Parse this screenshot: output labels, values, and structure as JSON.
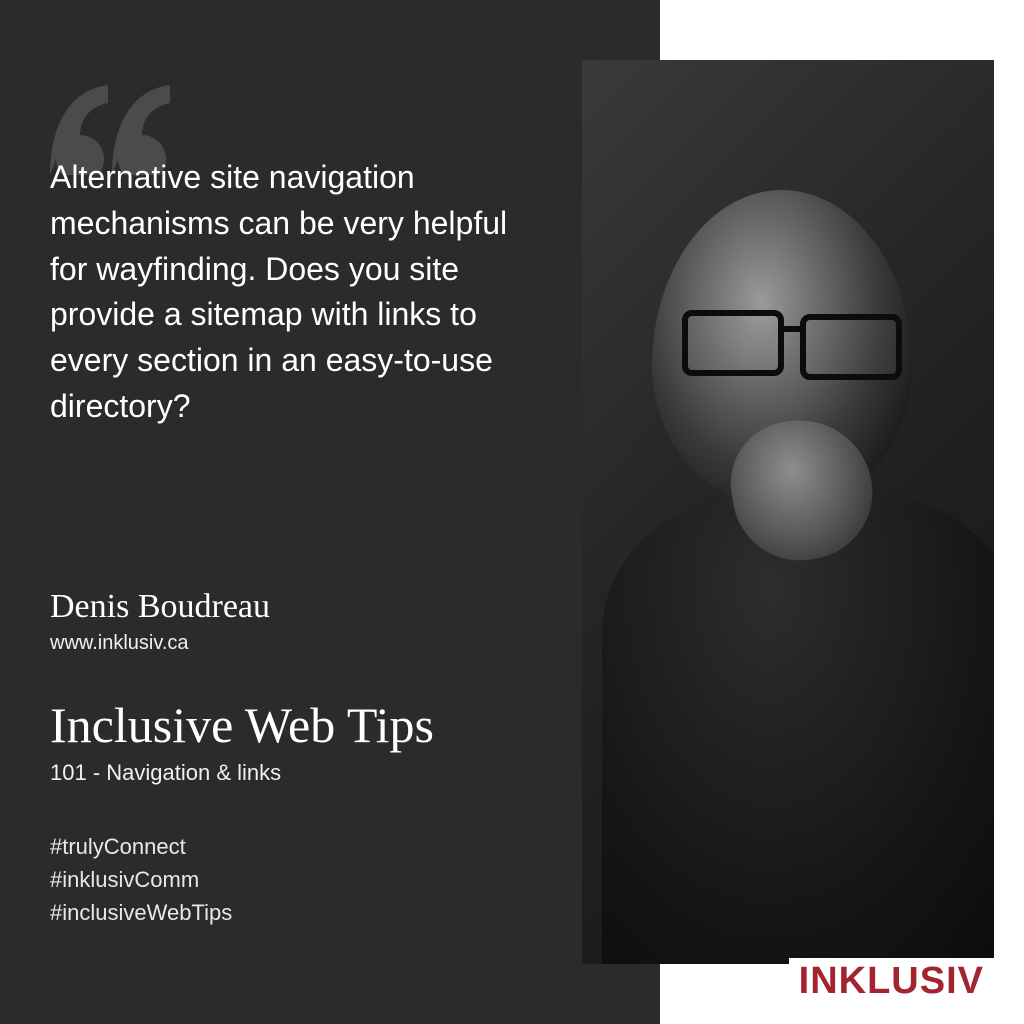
{
  "quote": "Alternative site navigation mechanisms can be very helpful for wayfinding. Does you site provide a sitemap with links to every section in an easy-to-use directory?",
  "author": "Denis Boudreau",
  "website": "www.inklusiv.ca",
  "series": {
    "title": "Inclusive Web Tips",
    "subtitle": "101 - Navigation & links"
  },
  "hashtags": [
    "#trulyConnect",
    "#inklusivComm",
    "#inclusiveWebTips"
  ],
  "brand": "INKLUSIV",
  "colors": {
    "panel": "#2b2b2b",
    "brand": "#a2242f"
  }
}
